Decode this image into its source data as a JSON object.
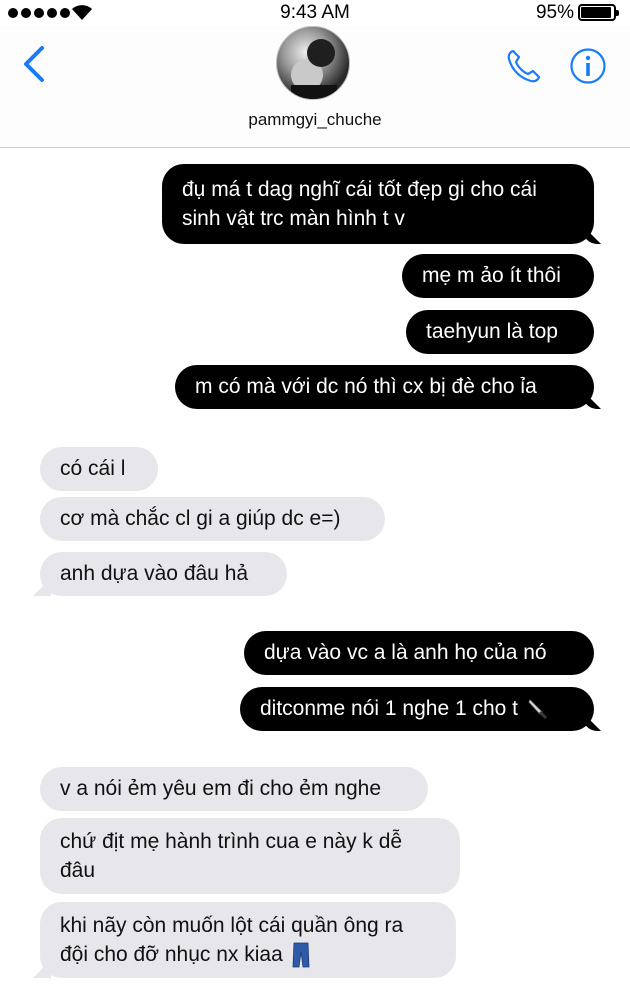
{
  "status_bar": {
    "time": "9:43 AM",
    "battery_percent": "95%",
    "battery_level": 0.95,
    "signal_dots": 5
  },
  "header": {
    "contact_name": "pammgyi_chuche",
    "back_icon": "chevron-left-icon",
    "call_icon": "phone-icon",
    "info_icon": "info-icon",
    "accent_color": "#1a7cf5"
  },
  "messages": [
    {
      "direction": "out",
      "text": "đụ má t dag nghĩ cái tốt đẹp gi cho cái",
      "text2": "sinh vật trc màn hình t v"
    },
    {
      "direction": "out",
      "text": "mẹ m ảo ít thôi"
    },
    {
      "direction": "out",
      "text": "taehyun là top"
    },
    {
      "direction": "out",
      "text": "m có mà với dc nó thì  cx bị đè cho ỉa"
    },
    {
      "direction": "in",
      "text": "có cái l"
    },
    {
      "direction": "in",
      "text": "cơ mà chắc cl gi a giúp dc e=)"
    },
    {
      "direction": "in",
      "text": "anh dựa vào đâu hả"
    },
    {
      "direction": "out",
      "text": "dựa vào vc a là anh họ của nó"
    },
    {
      "direction": "out",
      "text": "ditconme nói 1 nghe 1 cho t",
      "emoji": "knife-emoji"
    },
    {
      "direction": "in",
      "text": "v a nói ẻm yêu em đi cho ẻm nghe"
    },
    {
      "direction": "in",
      "text": "chứ địt mẹ hành trình cua e này k dễ",
      "text2": "đâu"
    },
    {
      "direction": "in",
      "text": "khi nãy còn muốn lột cái quần ông ra",
      "text2": "đội cho đỡ nhục nx kiaa",
      "emoji": "jeans-emoji"
    }
  ],
  "colors": {
    "outgoing_bubble": "#000000",
    "incoming_bubble": "#e6e6eb"
  }
}
